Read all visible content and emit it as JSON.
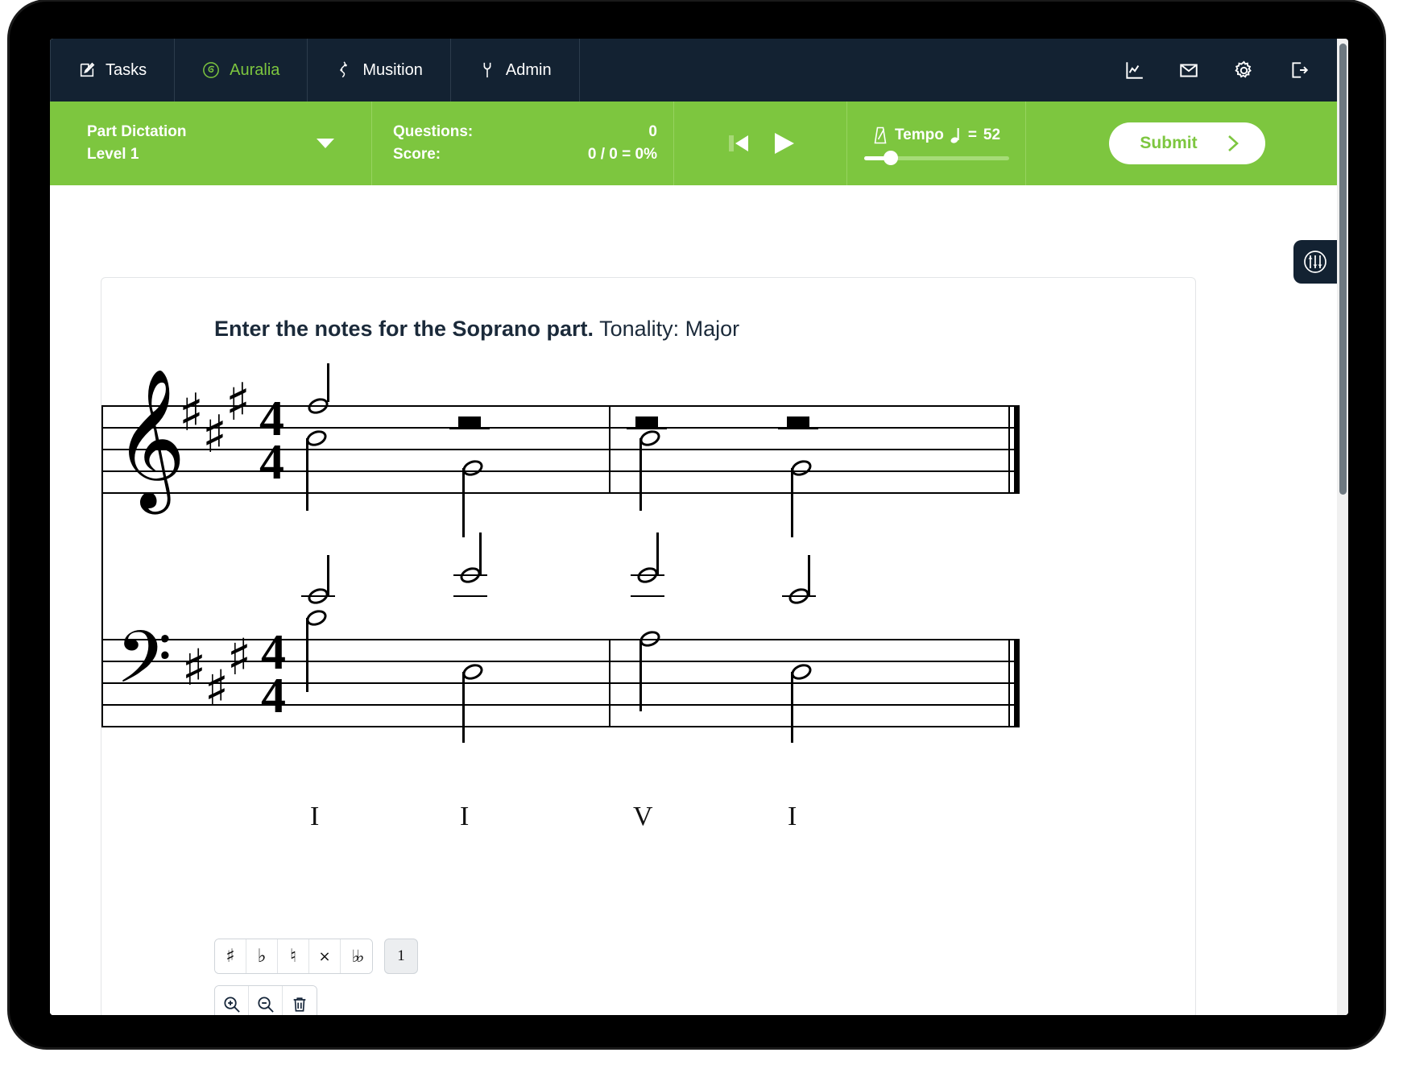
{
  "nav": {
    "items": [
      {
        "label": "Tasks",
        "icon": "pencil-square-icon",
        "active": false
      },
      {
        "label": "Auralia",
        "icon": "auralia-spiral-icon",
        "active": true
      },
      {
        "label": "Musition",
        "icon": "musition-clef-icon",
        "active": false
      },
      {
        "label": "Admin",
        "icon": "wrench-icon",
        "active": false
      }
    ],
    "right_icons": [
      {
        "name": "reports-chart-icon"
      },
      {
        "name": "mail-icon"
      },
      {
        "name": "gear-icon"
      },
      {
        "name": "logout-icon"
      }
    ]
  },
  "toolbar": {
    "exercise_name": "Part Dictation",
    "level": "Level 1",
    "questions_label": "Questions:",
    "questions_value": "0",
    "score_label": "Score:",
    "score_value": "0 / 0 = 0%",
    "transport": {
      "rewind": "skip-to-start-icon",
      "play": "play-icon"
    },
    "tempo_label": "Tempo",
    "tempo_equals": "=",
    "tempo_value": "52",
    "tempo_note_symbol": "quarter-note",
    "submit_label": "Submit"
  },
  "content": {
    "prompt_bold": "Enter the notes for the Soprano part.",
    "prompt_normal": "Tonality: Major"
  },
  "score": {
    "key_signature_sharps": 3,
    "time_signature": {
      "numerator": "4",
      "denominator": "4"
    },
    "treble_clef": "treble-clef",
    "bass_clef": "bass-clef",
    "measures": 2,
    "roman_numerals": [
      "I",
      "I",
      "V",
      "I"
    ]
  },
  "tools": {
    "accidentals": [
      {
        "name": "sharp-button",
        "glyph": "♯"
      },
      {
        "name": "flat-button",
        "glyph": "♭"
      },
      {
        "name": "natural-button",
        "glyph": "♮"
      },
      {
        "name": "double-sharp-button",
        "glyph": "×"
      },
      {
        "name": "double-flat-button",
        "glyph": "♭♭"
      }
    ],
    "voice_button": "1",
    "zoom_buttons": [
      {
        "name": "zoom-in-button",
        "icon": "magnifier-plus-icon"
      },
      {
        "name": "zoom-out-button",
        "icon": "magnifier-minus-icon"
      },
      {
        "name": "delete-button",
        "icon": "trash-icon"
      }
    ]
  },
  "panel_toggle": {
    "icon": "equalizer-sliders-icon"
  },
  "colors": {
    "navbar": "#132232",
    "accent_green": "#7dc63f",
    "text_dark": "#1b2a3a"
  }
}
